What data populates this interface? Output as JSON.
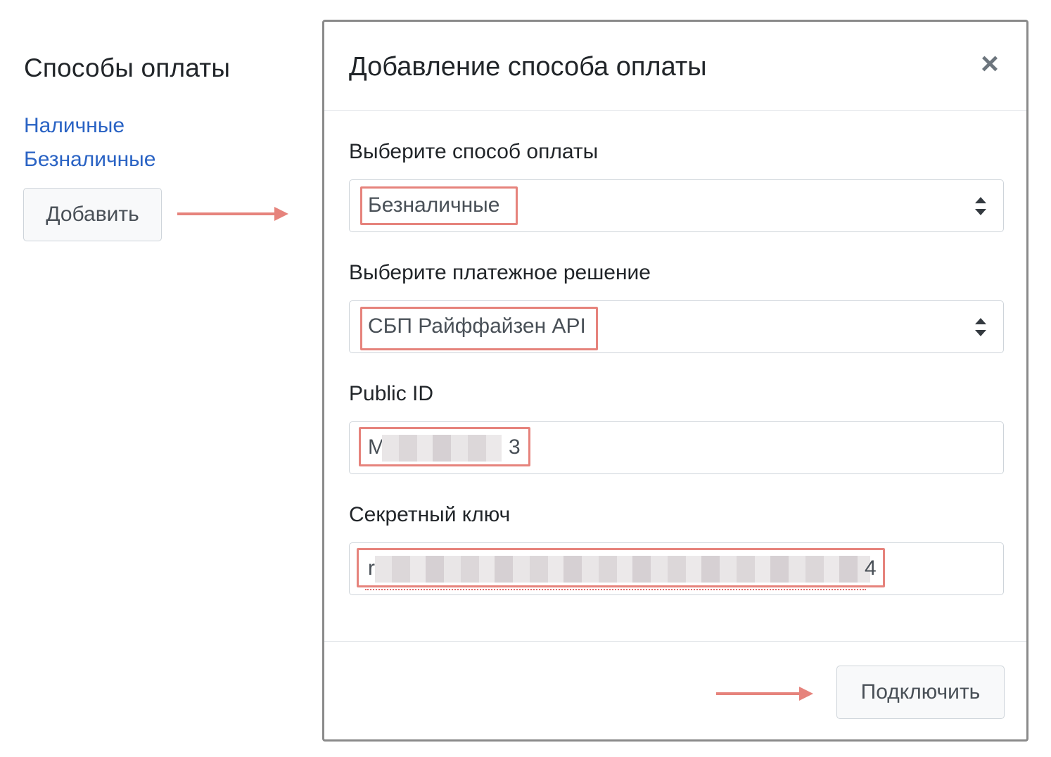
{
  "page": {
    "title": "Способы оплаты",
    "links": [
      {
        "label": "Наличные"
      },
      {
        "label": "Безналичные"
      }
    ],
    "add_button": "Добавить"
  },
  "modal": {
    "title": "Добавление способа оплаты",
    "close_glyph": "×",
    "fields": {
      "payment_method": {
        "label": "Выберите способ оплаты",
        "value": "Безналичные"
      },
      "payment_solution": {
        "label": "Выберите платежное решение",
        "value": "СБП Райффайзен API"
      },
      "public_id": {
        "label": "Public ID",
        "value_start": "M",
        "value_end": "3"
      },
      "secret_key": {
        "label": "Секретный ключ",
        "value_start": "r",
        "value_end": "4"
      }
    },
    "connect_button": "Подключить"
  },
  "annotation": {
    "color": "#e6837c"
  }
}
